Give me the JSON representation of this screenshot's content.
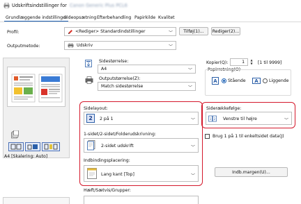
{
  "window": {
    "title": "Udskriftsindstillinger for",
    "title_device": "Canon Generic Plus PCL6"
  },
  "tabs": [
    "Grundlæggende indstillinger",
    "Sideopsætning",
    "Efterbehandling",
    "Papirkilde",
    "Kvalitet"
  ],
  "profile": {
    "label": "Profil:",
    "value": "<Rediger> Standardindstillinger",
    "add_btn": "Tilføj(1)...",
    "edit_btn": "Rediger(2)..."
  },
  "output_method": {
    "label": "Outputmetode:",
    "value": "Udskriv"
  },
  "page_size": {
    "label": "Sidestørrelse:",
    "value": "A4"
  },
  "output_size": {
    "label": "Outputstørrelse(Z):",
    "value": "Match sidestørrelse"
  },
  "copies": {
    "label": "Kopier(Q):",
    "value": "1",
    "range": "[1 til 9999]"
  },
  "orientation": {
    "label": "Papirretning(O)",
    "portrait": "Stående",
    "landscape": "Liggende"
  },
  "layout": {
    "label": "Sidelayout:",
    "badge": "2",
    "value": "2 på 1"
  },
  "page_order": {
    "label": "Siderækkefølge:",
    "value": "Venstre til højre"
  },
  "duplex": {
    "label": "1-sidet/2-sidet/Folderudskrivning:",
    "value": "2-sidet udskrift"
  },
  "binding": {
    "label": "Indbindingsplacering:",
    "value": "Lang kant [Top]",
    "margin_btn": "Indb.margen(U)..."
  },
  "single_sheet": {
    "label": "Brug 1 på 1 til enkeltsidet data(J)"
  },
  "preview": {
    "caption": "A4 [Skalering: Auto]"
  },
  "staple": {
    "label": "Hæft/Sætvis/Grupper:"
  },
  "colors": {
    "accent": "#1a5fb4",
    "red_box": "#d4182b",
    "badge_bg": "#dfe6f7"
  }
}
